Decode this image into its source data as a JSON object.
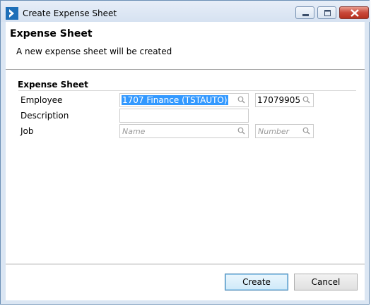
{
  "window": {
    "title": "Create Expense Sheet"
  },
  "header": {
    "title": "Expense Sheet",
    "description": "A new expense sheet will be created"
  },
  "section": {
    "title": "Expense Sheet"
  },
  "form": {
    "employee": {
      "label": "Employee",
      "value": "1707 Finance (TSTAUTO)",
      "number": "17079905"
    },
    "description": {
      "label": "Description",
      "value": ""
    },
    "job": {
      "label": "Job",
      "name_placeholder": "Name",
      "number_placeholder": "Number"
    }
  },
  "buttons": {
    "create": "Create",
    "cancel": "Cancel"
  },
  "icons": {
    "app": "app-logo-icon",
    "lookup": "magnifier-icon"
  }
}
